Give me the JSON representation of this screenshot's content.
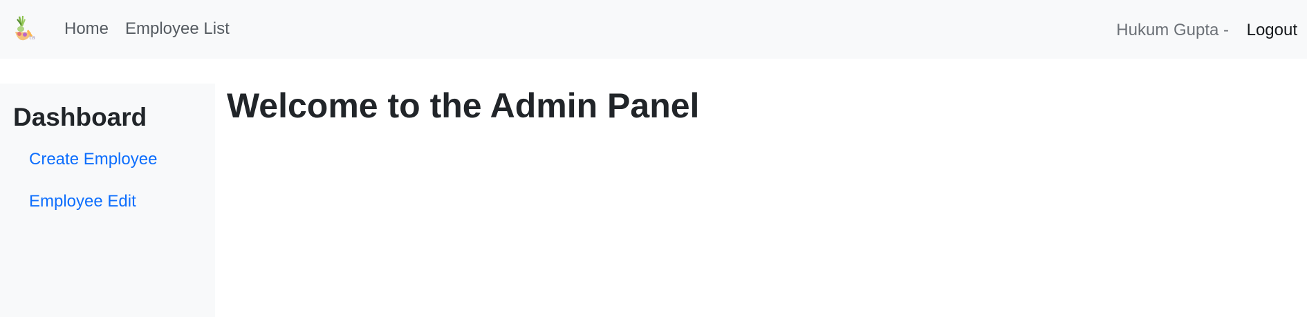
{
  "navbar": {
    "logo_icon": "vegetable-basket-logo-icon",
    "links": [
      {
        "label": "Home"
      },
      {
        "label": "Employee List"
      }
    ],
    "user": {
      "name": "Hukum Gupta -",
      "logout_label": "Logout"
    }
  },
  "sidebar": {
    "title": "Dashboard",
    "links": [
      {
        "label": "Create Employee"
      },
      {
        "label": "Employee Edit"
      }
    ]
  },
  "main": {
    "title": "Welcome to the Admin Panel"
  },
  "colors": {
    "navbar_bg": "#f8f9fa",
    "sidebar_bg": "#f8f9fa",
    "link": "#0d6efd",
    "text": "#212529"
  }
}
